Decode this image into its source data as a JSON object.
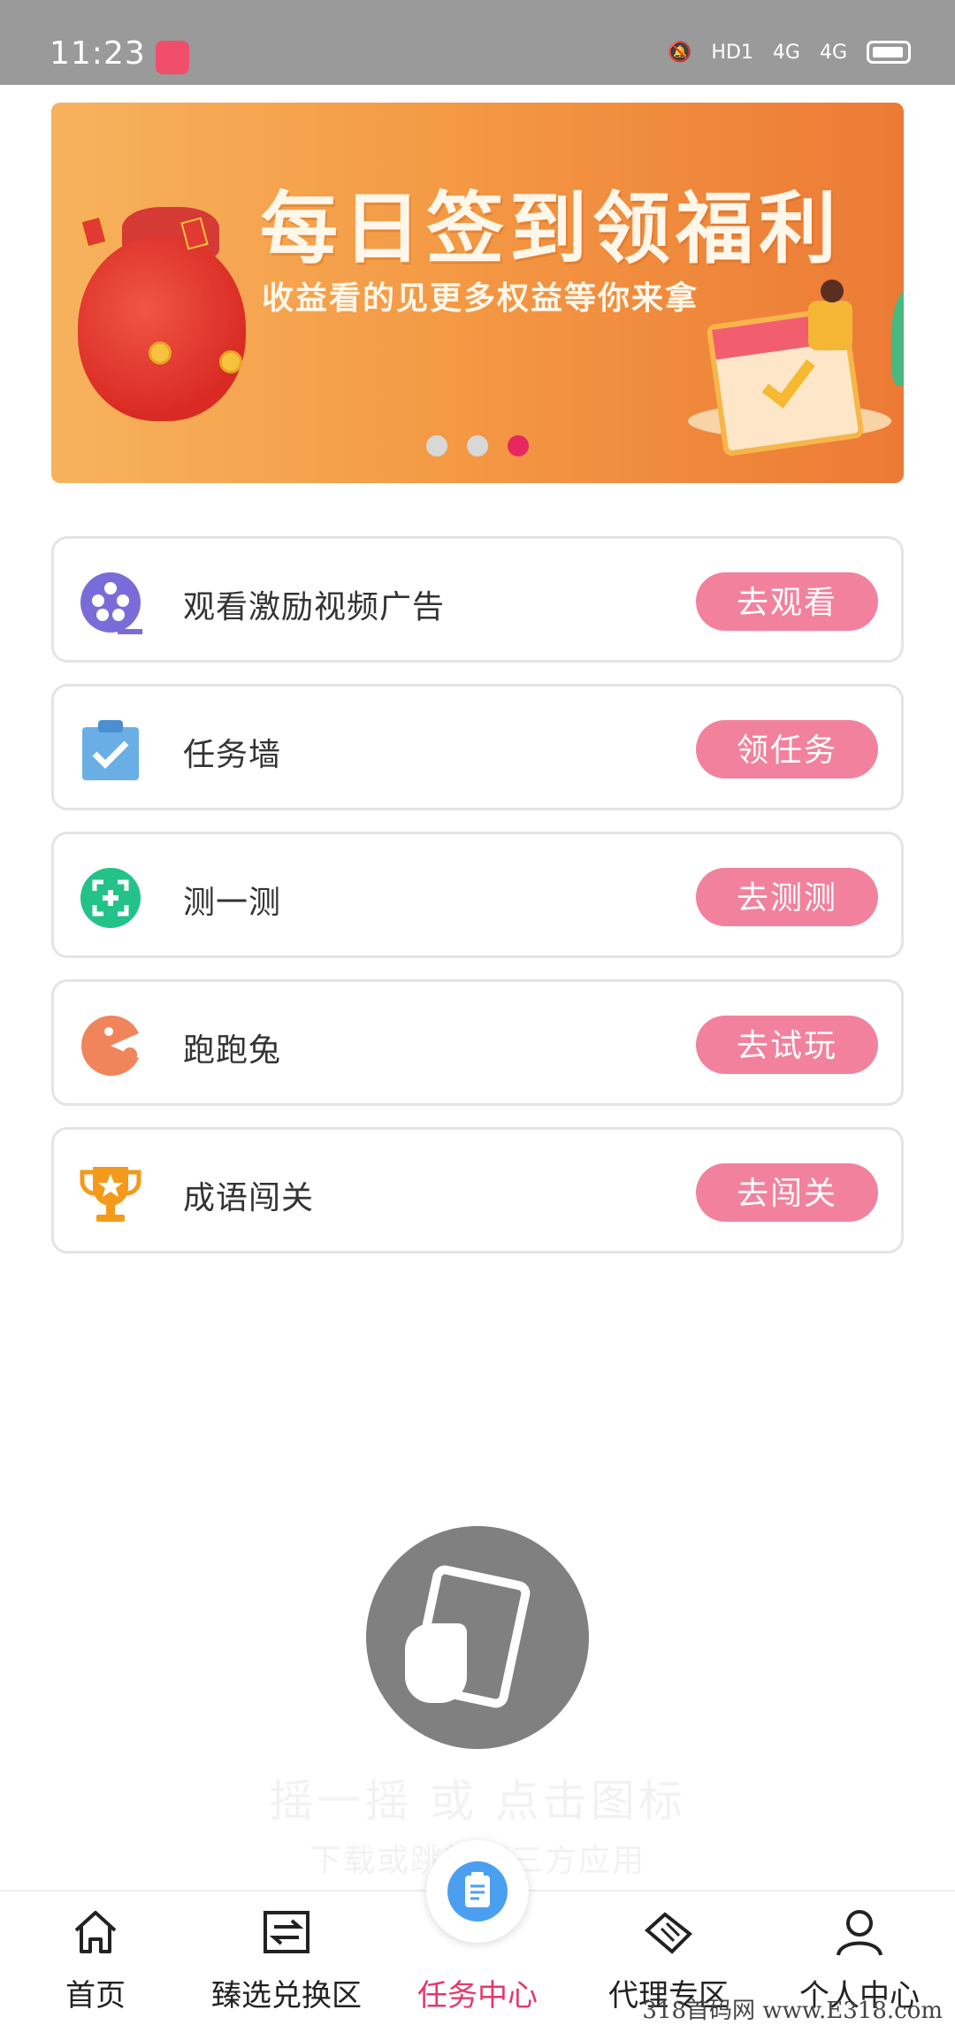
{
  "status_bar": {
    "time": "11:23",
    "hd_label": "HD1",
    "network1": "4G",
    "network2": "4G"
  },
  "banner": {
    "title": "每日签到领福利",
    "subtitle": "收益看的见更多权益等你来拿",
    "dots": 3,
    "active_dot": 3
  },
  "tasks": [
    {
      "label": "观看激励视频广告",
      "button": "去观看",
      "icon": "film-reel-icon",
      "icon_color": "#7a6cd8"
    },
    {
      "label": "任务墙",
      "button": "领任务",
      "icon": "clipboard-check-icon",
      "icon_color": "#6aaee6"
    },
    {
      "label": "测一测",
      "button": "去测测",
      "icon": "scan-plus-icon",
      "icon_color": "#23c28b"
    },
    {
      "label": "跑跑兔",
      "button": "去试玩",
      "icon": "pacman-icon",
      "icon_color": "#f0845b"
    },
    {
      "label": "成语闯关",
      "button": "去闯关",
      "icon": "trophy-icon",
      "icon_color": "#f49a1a"
    }
  ],
  "shake": {
    "title": "摇一摇 或 点击图标",
    "subtitle": "下载或跳转第三方应用"
  },
  "bottom_nav": {
    "items": [
      {
        "label": "首页",
        "icon": "home-icon"
      },
      {
        "label": "臻选兑换区",
        "icon": "exchange-icon"
      },
      {
        "label": "任务中心",
        "icon": "clipboard-icon",
        "active": true
      },
      {
        "label": "代理专区",
        "icon": "handshake-icon"
      },
      {
        "label": "个人中心",
        "icon": "user-icon"
      }
    ]
  },
  "watermark": "318首码网 www.E318.com",
  "colors": {
    "accent_pink": "#f2819e",
    "nav_active": "#e5386a",
    "banner_orange": "#f49a45"
  }
}
